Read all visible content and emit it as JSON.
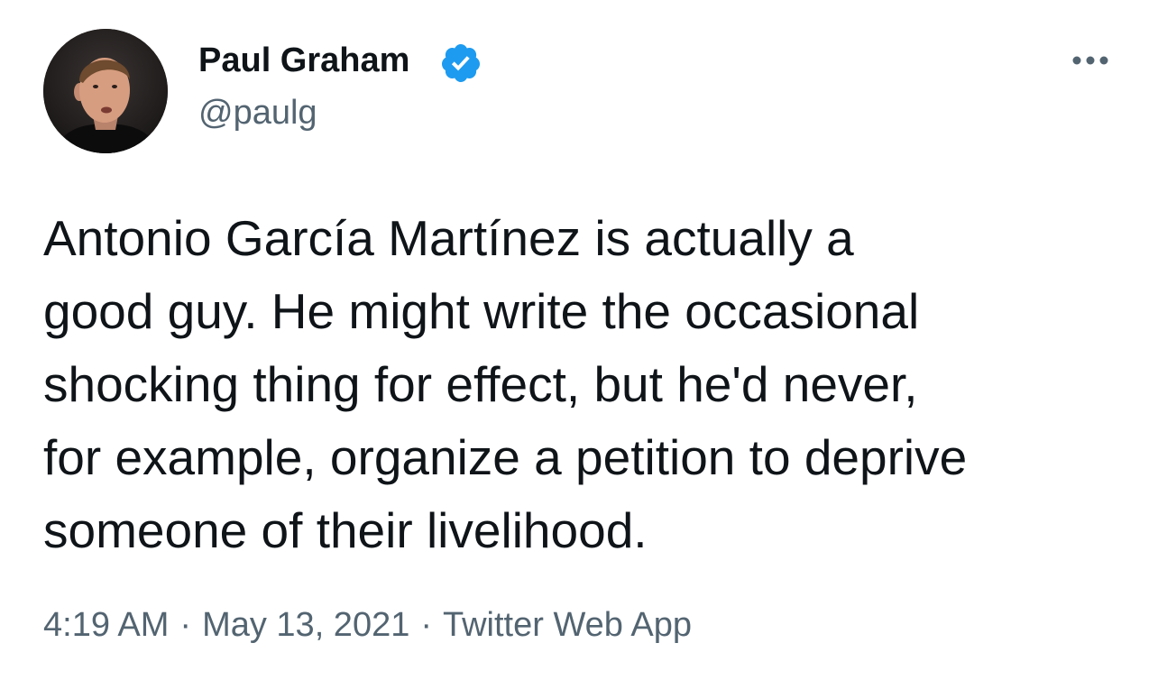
{
  "tweet": {
    "author": {
      "name": "Paul Graham",
      "handle": "@paulg",
      "verified": true
    },
    "text": "Antonio García Martínez is actually a\ngood guy. He might write the occasional\nshocking thing for effect, but he'd never,\nfor example, organize a petition to deprive\nsomeone of their livelihood.",
    "time": "4:19 AM",
    "separator": "·",
    "date": "May 13, 2021",
    "source": "Twitter Web App"
  },
  "icons": {
    "verified": "verified-badge-icon",
    "more": "more-options-icon"
  },
  "colors": {
    "text": "#0f1419",
    "secondary": "#536471",
    "verified": "#1d9bf0",
    "background": "#ffffff"
  }
}
